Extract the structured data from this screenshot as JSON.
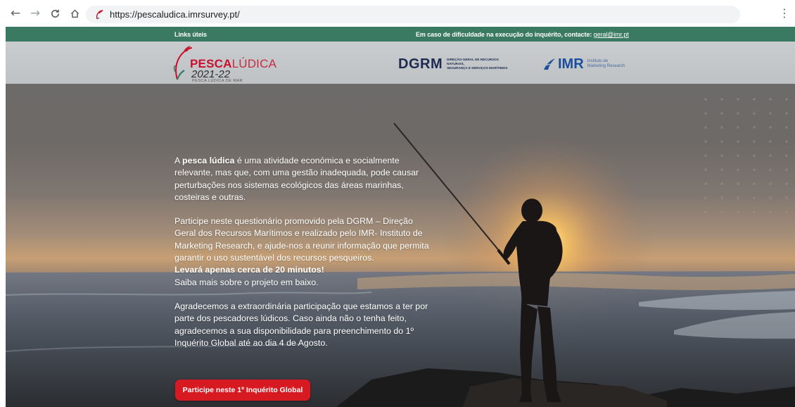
{
  "browser": {
    "url": "https://pescaludica.imrsurvey.pt/",
    "icons": [
      "back-arrow-icon",
      "forward-arrow-icon",
      "reload-icon",
      "home-icon",
      "site-favicon-icon",
      "kebab-menu-icon"
    ]
  },
  "topbar": {
    "links_label": "Links úteis",
    "contact_text": "Em caso de dificuldade na execução do inquérito, contacte:",
    "contact_email": "geral@imr.pt"
  },
  "header": {
    "pesca_logo": {
      "brand_bold": "PESCA",
      "brand_light": "LÚDICA",
      "year": "2021-22",
      "tagline": "PESCA LÚDICA DE MAR"
    },
    "dgrm_logo": {
      "word": "DGRM",
      "sub_line1": "DIREÇÃO-GERAL DE RECURSOS NATURAIS,",
      "sub_line2": "SEGURANÇA E SERVIÇOS MARÍTIMOS"
    },
    "imr_logo": {
      "word": "IMR",
      "sub_line1": "Instituto de",
      "sub_line2": "Marketing Research"
    }
  },
  "hero": {
    "p1_lead": "A ",
    "p1_bold": "pesca lúdica",
    "p1_rest": " é uma atividade económica e socialmente relevante, mas que, com uma gestão inadequada, pode causar perturbações nos sistemas ecológicos das áreas marinhas, costeiras e outras.",
    "p2_text": "Participe neste questionário promovido pela DGRM – Direção Geral dos Recursos Marítimos e realizado pelo IMR- Instituto de Marketing Research, e ajude-nos a reunir informação que permita garantir o uso sustentável dos recursos pesqueiros.",
    "p2_bold": "Levará apenas cerca de 20 minutos!",
    "p2_tail": "Saiba mais sobre o projeto em baixo.",
    "p3_text": "Agradecemos a extraordinária participação que estamos a ter por parte dos pescadores lúdicos. Caso ainda não o tenha feito, agradecemos a sua disponibilidade para preenchimento do 1º Inquérito Global até ao dia 4 de Agosto.",
    "cta_label": "Participe neste 1º Inquérito Global"
  },
  "colors": {
    "topbar_bg": "#3b7a62",
    "header_bg": "#c9ccce",
    "cta_bg": "#d71921",
    "pesca_red": "#c8102e",
    "dgrm_navy": "#1d2b50",
    "imr_blue": "#1b4f9b"
  }
}
